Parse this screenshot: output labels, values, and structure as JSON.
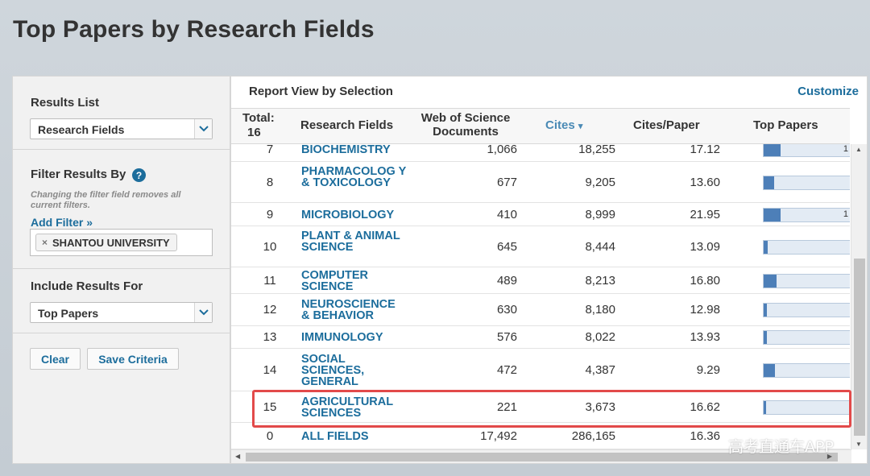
{
  "page_title": "Top Papers by Research Fields",
  "left_panel": {
    "results_list": {
      "heading": "Results List",
      "selected": "Research Fields"
    },
    "filter": {
      "heading": "Filter Results By",
      "help": "?",
      "note": "Changing the filter field removes all current filters.",
      "add_filter": "Add Filter »",
      "chip_remove": "×",
      "chip_label": "SHANTOU UNIVERSITY"
    },
    "include": {
      "heading": "Include Results For",
      "selected": "Top Papers"
    },
    "buttons": {
      "clear": "Clear",
      "save": "Save Criteria"
    }
  },
  "report": {
    "title": "Report View by Selection",
    "customize": "Customize",
    "headers": {
      "total_label": "Total:",
      "total_value": "16",
      "field": "Research Fields",
      "docs_line1": "Web of Science",
      "docs_line2": "Documents",
      "cites": "Cites",
      "cites_sort_icon": "▾",
      "cpp": "Cites/Paper",
      "top": "Top Papers"
    },
    "rows": [
      {
        "rank": "7",
        "field": "BIOLOGY & BIOCHEMISTRY",
        "docs": "1,066",
        "cites": "18,255",
        "cpp": "17.12",
        "top_fraction": 0.2,
        "top_label": "1"
      },
      {
        "rank": "8",
        "field": "PHARMACOLOG Y & TOXICOLOGY",
        "docs": "677",
        "cites": "9,205",
        "cpp": "13.60",
        "top_fraction": 0.12,
        "top_label": ""
      },
      {
        "rank": "9",
        "field": "MICROBIOLOGY",
        "docs": "410",
        "cites": "8,999",
        "cpp": "21.95",
        "top_fraction": 0.2,
        "top_label": "1"
      },
      {
        "rank": "10",
        "field": "PLANT & ANIMAL SCIENCE",
        "docs": "645",
        "cites": "8,444",
        "cpp": "13.09",
        "top_fraction": 0.05,
        "top_label": ""
      },
      {
        "rank": "11",
        "field": "COMPUTER SCIENCE",
        "docs": "489",
        "cites": "8,213",
        "cpp": "16.80",
        "top_fraction": 0.15,
        "top_label": ""
      },
      {
        "rank": "12",
        "field": "NEUROSCIENCE & BEHAVIOR",
        "docs": "630",
        "cites": "8,180",
        "cpp": "12.98",
        "top_fraction": 0.04,
        "top_label": ""
      },
      {
        "rank": "13",
        "field": "IMMUNOLOGY",
        "docs": "576",
        "cites": "8,022",
        "cpp": "13.93",
        "top_fraction": 0.04,
        "top_label": ""
      },
      {
        "rank": "14",
        "field": "SOCIAL SCIENCES, GENERAL",
        "docs": "472",
        "cites": "4,387",
        "cpp": "9.29",
        "top_fraction": 0.13,
        "top_label": ""
      },
      {
        "rank": "15",
        "field": "AGRICULTURAL SCIENCES",
        "docs": "221",
        "cites": "3,673",
        "cpp": "16.62",
        "top_fraction": 0.03,
        "top_label": ""
      },
      {
        "rank": "0",
        "field": "ALL FIELDS",
        "docs": "17,492",
        "cites": "286,165",
        "cpp": "16.36",
        "top_fraction": 0,
        "top_label": ""
      }
    ]
  },
  "watermark": "高考直通车APP",
  "accent_color": "#1c6d9c",
  "highlight_color": "#e24a4a"
}
